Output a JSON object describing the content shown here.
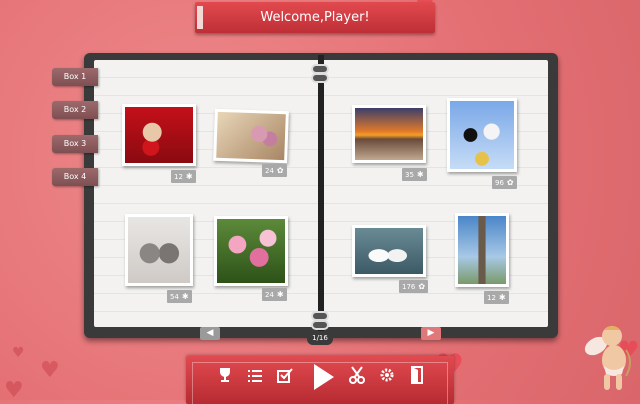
{
  "header": {
    "welcome": "Welcome,Player!"
  },
  "sidebar": {
    "tabs": [
      {
        "label": "Box 1"
      },
      {
        "label": "Box 2"
      },
      {
        "label": "Box 3"
      },
      {
        "label": "Box 4"
      }
    ]
  },
  "puzzles": [
    {
      "subject": "teddy-bear-with-heart",
      "pieces": "12",
      "icon": "puzzle-piece-icon"
    },
    {
      "subject": "roses-on-book",
      "pieces": "24",
      "icon": "cog-icon"
    },
    {
      "subject": "kittens",
      "pieces": "54",
      "icon": "puzzle-piece-icon"
    },
    {
      "subject": "pink-flowers",
      "pieces": "24",
      "icon": "puzzle-piece-icon"
    },
    {
      "subject": "sunset-sea",
      "pieces": "35",
      "icon": "puzzle-piece-icon"
    },
    {
      "subject": "wedding-toppers",
      "pieces": "96",
      "icon": "cog-icon"
    },
    {
      "subject": "swans",
      "pieces": "176",
      "icon": "cog-icon"
    },
    {
      "subject": "eiffel-tower",
      "pieces": "12",
      "icon": "puzzle-piece-icon"
    }
  ],
  "pager": {
    "page": "1/16",
    "prev": "◀",
    "next": "▶"
  },
  "toolbar": {
    "icons": [
      "trophy-icon",
      "list-icon",
      "checkbox-icon",
      "play-icon",
      "scissors-icon",
      "settings-icon",
      "exit-door-icon"
    ]
  },
  "colors": {
    "background": "#e47074",
    "banner": "#d43c43",
    "tab": "#8c5c5e",
    "next_arrow": "#e0787a"
  }
}
